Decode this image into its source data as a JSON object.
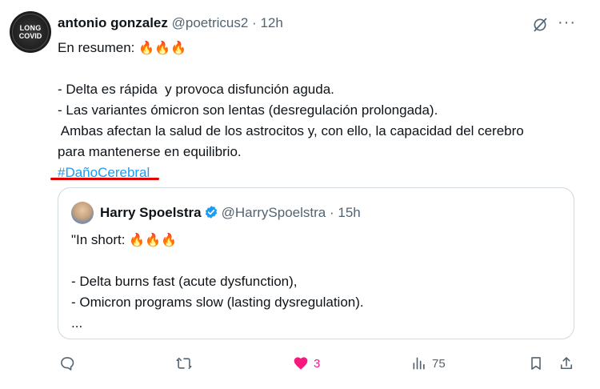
{
  "tweet": {
    "author_name": "antonio gonzalez",
    "handle": "@poetricus2",
    "separator": " · ",
    "time": "12h",
    "avatar_text_line1": "LONG",
    "avatar_text_line2": "COVID",
    "text_intro": "En resumen: ",
    "emoji": "🔥🔥🔥",
    "lines": [
      "- Delta es rápida  y provoca disfunción aguda.",
      "- Las variantes ómicron son lentas (desregulación prolongada).",
      " Ambas afectan la salud de los astrocitos y, con ello, la capacidad del cerebro",
      "para mantenerse en equilibrio."
    ],
    "hashtag": "#DañoCerebral"
  },
  "quote": {
    "author_name": "Harry Spoelstra",
    "handle": "@HarrySpoelstra",
    "separator": " · ",
    "time": "15h",
    "text_intro": "\"In short: ",
    "emoji": "🔥🔥🔥",
    "lines": [
      "- Delta burns fast (acute dysfunction),",
      "- Omicron programs slow (lasting dysregulation).",
      "..."
    ]
  },
  "actions": {
    "reply_count": "",
    "retweet_count": "",
    "like_count": "3",
    "views_count": "75"
  },
  "colors": {
    "accent": "#1d9bf0",
    "like": "#f91880",
    "muted": "#536471",
    "underline": "#e00000"
  },
  "icons": [
    "grok-icon",
    "more-icon",
    "verified-icon",
    "reply-icon",
    "retweet-icon",
    "heart-icon",
    "views-icon",
    "bookmark-icon",
    "share-icon"
  ]
}
